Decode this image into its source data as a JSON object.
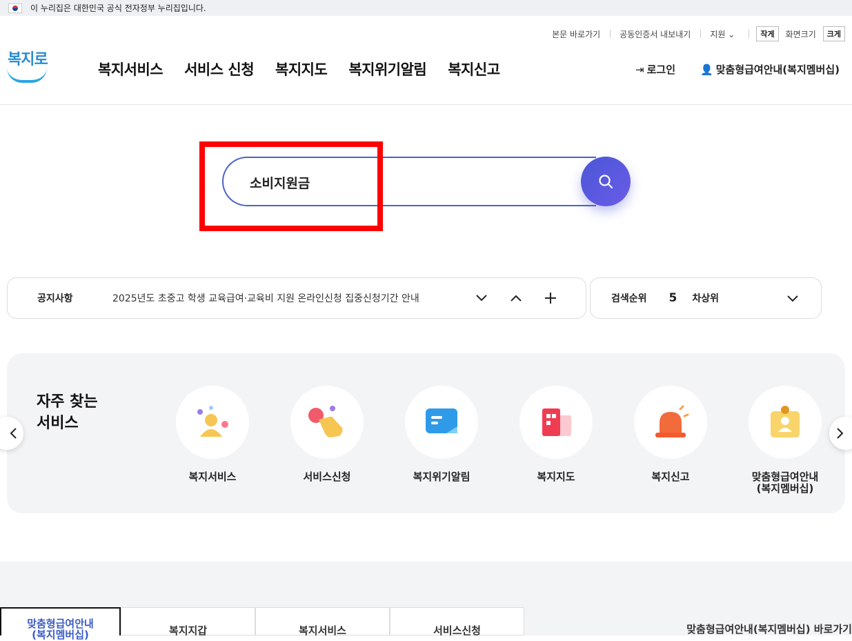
{
  "gov_banner": {
    "text": "이 누리집은 대한민국 공식 전자정부 누리집입니다."
  },
  "utility": {
    "skip_to_content": "본문 바로가기",
    "export_certificate": "공동인증서 내보내기",
    "support": "지원",
    "font_small": "작게",
    "screen_size": "화면크기",
    "font_large": "크게"
  },
  "logo": {
    "text": "복지로"
  },
  "gnb": [
    "복지서비스",
    "서비스 신청",
    "복지지도",
    "복지위기알림",
    "복지신고"
  ],
  "header_right": {
    "login": "로그인",
    "membership": "맞춤형급여안내(복지멤버십)"
  },
  "search": {
    "value": "소비지원금"
  },
  "notice": {
    "title": "공지사항",
    "text": "2025년도 초중고 학생 교육급여·교육비 지원 온라인신청 집중신청기간 안내"
  },
  "search_rank": {
    "title": "검색순위",
    "number": "5",
    "text": "차상위"
  },
  "frequent": {
    "title": "자주 찾는\n서비스",
    "items": [
      {
        "label": "복지서비스",
        "icon": "person-icon"
      },
      {
        "label": "서비스신청",
        "icon": "tap-hand-icon"
      },
      {
        "label": "복지위기알림",
        "icon": "chat-bubble-icon"
      },
      {
        "label": "복지지도",
        "icon": "building-icon"
      },
      {
        "label": "복지신고",
        "icon": "siren-icon"
      },
      {
        "label": "맞춤형급여안내\n(복지멤버십)",
        "icon": "id-badge-icon"
      }
    ]
  },
  "bottom_tabs": [
    "맞춤형급여안내\n(복지멤버십)",
    "복지지갑",
    "복지서비스",
    "서비스신청"
  ],
  "bottom_link": "맞춤형급여안내(복지멤버십) 바로가기",
  "colors": {
    "accent": "#4a63c8",
    "highlight_box": "#ff0000",
    "active_tab_text": "#3a5bc7"
  }
}
